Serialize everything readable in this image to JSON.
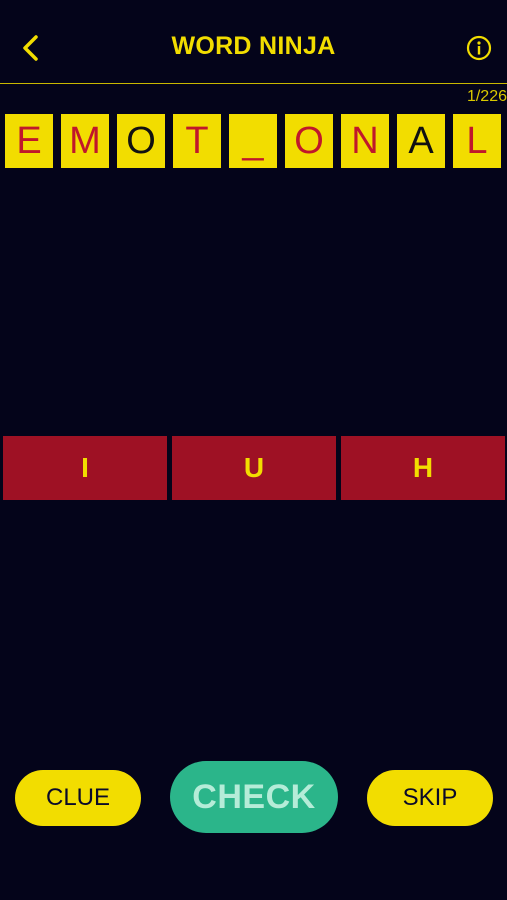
{
  "header": {
    "title": "WORD NINJA",
    "back_icon": "chevron-left-icon",
    "info_icon": "info-icon"
  },
  "progress": "1/226",
  "word": {
    "tiles": [
      {
        "char": "E",
        "state": "given"
      },
      {
        "char": "M",
        "state": "given"
      },
      {
        "char": "O",
        "state": "guess"
      },
      {
        "char": "T",
        "state": "given"
      },
      {
        "char": "_",
        "state": "given"
      },
      {
        "char": "O",
        "state": "given"
      },
      {
        "char": "N",
        "state": "given"
      },
      {
        "char": "A",
        "state": "guess"
      },
      {
        "char": "L",
        "state": "given"
      }
    ]
  },
  "choices": [
    "I",
    "U",
    "H"
  ],
  "buttons": {
    "clue": "CLUE",
    "check": "CHECK",
    "skip": "SKIP"
  },
  "colors": {
    "background": "#04041a",
    "accent_yellow": "#f2dd00",
    "tile_red": "#9e1124",
    "given_letter": "#c0172b",
    "check_green": "#2bb58a"
  }
}
